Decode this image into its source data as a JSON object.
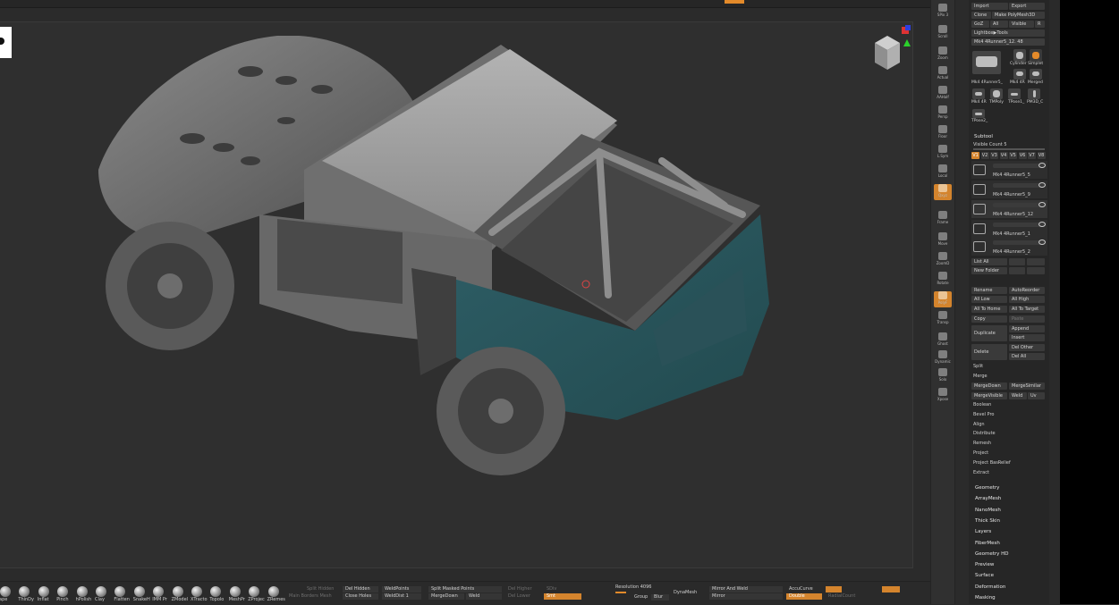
{
  "panel": {
    "top_buttons": [
      "Import",
      "Export",
      "Clone",
      "Make PolyMesh3D",
      "GoZ",
      "All",
      "Visible",
      "R",
      "Lightbox▶Tools"
    ],
    "current_tool": "Mk4 4Runner5_12. 48",
    "tool_thumbs": [
      {
        "label": "Mk4 4Runner5_"
      },
      {
        "label": "Cylinder Simplet"
      },
      {
        "label": "Mk4 4R"
      },
      {
        "label": "Merged"
      },
      {
        "label": "Mk4 4R"
      },
      {
        "label": "TMPoly"
      },
      {
        "label": "TPose1_"
      },
      {
        "label": "PM3D_C"
      },
      {
        "label": "TPose2_"
      }
    ],
    "subtool_header": "Subtool",
    "visible_count": "Visible Count 5",
    "versions": [
      "V1",
      "V2",
      "V3",
      "V4",
      "V5",
      "V6",
      "V7",
      "V8"
    ],
    "subtools": [
      {
        "name": "Mk4 4Runner5_5"
      },
      {
        "name": "Mk4 4Runner5_9"
      },
      {
        "name": "Mk4 4Runner5_12"
      },
      {
        "name": "Mk4 4Runner5_1"
      },
      {
        "name": "Mk4 4Runner5_2"
      }
    ],
    "list_all": "List All",
    "new_folder": "New Folder",
    "rename": "Rename",
    "auto_reorder": "AutoReorder",
    "all_low": "All Low",
    "all_high": "All High",
    "all_to_home": "All To Home",
    "all_to_target": "All To Target",
    "copy": "Copy",
    "paste": "Paste",
    "append": "Append",
    "duplicate": "Duplicate",
    "insert": "Insert",
    "delete": "Delete",
    "del_other": "Del Other",
    "del_all": "Del All",
    "split": "Split",
    "merge": "Merge",
    "merge_down": "MergeDown",
    "merge_similar": "MergeSimilar",
    "merge_visible": "MergeVisible",
    "weld": "Weld",
    "uv": "Uv",
    "more_items": [
      "Boolean",
      "Bevel Pro",
      "Align",
      "Distribute",
      "Remesh",
      "Project",
      "Project BasRelief",
      "Extract"
    ],
    "sections": [
      "Geometry",
      "ArrayMesh",
      "NanoMesh",
      "Thick Skin",
      "Layers",
      "FiberMesh",
      "Geometry HD",
      "Preview",
      "Surface",
      "Deformation",
      "Masking"
    ]
  },
  "shelf": [
    {
      "label": "SPix 3",
      "icon": "sphere-icon"
    },
    {
      "label": "Scroll",
      "icon": "scroll-icon"
    },
    {
      "label": "Zoom",
      "icon": "zoom-icon"
    },
    {
      "label": "Actual",
      "icon": "actual-icon"
    },
    {
      "label": "AAHalf",
      "icon": "aahalf-icon"
    },
    {
      "label": "Persp",
      "icon": "persp-icon"
    },
    {
      "label": "Floor",
      "icon": "floor-icon"
    },
    {
      "label": "L.Sym",
      "icon": "sym-icon"
    },
    {
      "label": "Local",
      "icon": "local-icon"
    },
    {
      "label": "Qxyz",
      "icon": "xyz-icon"
    },
    {
      "label": "Frame",
      "icon": "frame-icon"
    },
    {
      "label": "Move",
      "icon": "move-icon"
    },
    {
      "label": "ZoomD",
      "icon": "zoom3d-icon"
    },
    {
      "label": "Rotate",
      "icon": "rotate-icon"
    },
    {
      "label": "PolyF",
      "icon": "polyframe-icon"
    },
    {
      "label": "Transp",
      "icon": "transp-icon"
    },
    {
      "label": "Ghost",
      "icon": "ghost-icon"
    },
    {
      "label": "Dynamic",
      "icon": "dynamic-icon"
    },
    {
      "label": "Solo",
      "icon": "solo-icon"
    },
    {
      "label": "Xpose",
      "icon": "xpose-icon"
    }
  ],
  "brushes": [
    "ape",
    "ThinDy",
    "Inflat",
    "Pinch",
    "hPolish",
    "Clay",
    "Flatten",
    "SnakeH",
    "IMM Pr",
    "ZModel",
    "XTracto",
    "Topolo",
    "MeshPr",
    "ZProjec",
    "ZRemes"
  ],
  "bottom": {
    "split_hidden": "Split Hidden",
    "main_borders": "Main Borders Mesh",
    "del_hidden": "Del Hidden",
    "close_holes": "Close Holes",
    "weld_points": "WeldPoints",
    "weld_dist": "WeldDist 1",
    "split_masked": "Split Masked Points",
    "merge_down": "MergeDown",
    "weld": "Weld",
    "del_higher": "Del Higher",
    "del_lower": "Del Lower",
    "sdiv": "SDiv",
    "smt": "Smt",
    "resolution": "Resolution 4096",
    "group": "Group",
    "blur": "Blur",
    "dynamesh": "DynaMesh",
    "mirror_weld": "Mirror And Weld",
    "mirror": "Mirror",
    "accucurve": "AccuCurve",
    "double": "Double",
    "radial_count": "RadialCount"
  }
}
